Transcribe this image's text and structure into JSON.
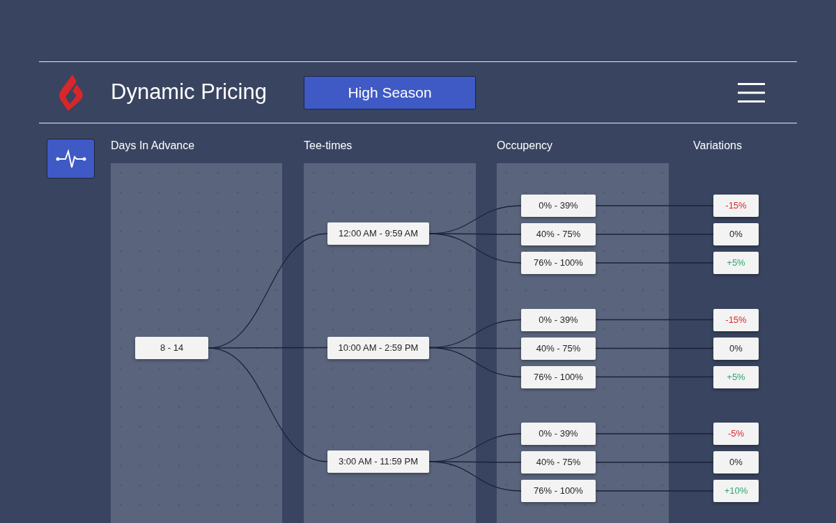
{
  "header": {
    "title": "Dynamic Pricing",
    "season_button": "High Season"
  },
  "columns": [
    "Days In Advance",
    "Tee-times",
    "Occupency",
    "Variations"
  ],
  "tree": {
    "label": "8 - 14",
    "children": [
      {
        "label": "12:00 AM - 9:59 AM",
        "children": [
          {
            "label": "0% - 39%",
            "variation": {
              "text": "-15%",
              "kind": "down"
            }
          },
          {
            "label": "40% - 75%",
            "variation": {
              "text": "0%",
              "kind": "flat"
            }
          },
          {
            "label": "76% - 100%",
            "variation": {
              "text": "+5%",
              "kind": "up"
            }
          }
        ]
      },
      {
        "label": "10:00 AM - 2:59 PM",
        "children": [
          {
            "label": "0% - 39%",
            "variation": {
              "text": "-15%",
              "kind": "down"
            }
          },
          {
            "label": "40% - 75%",
            "variation": {
              "text": "0%",
              "kind": "flat"
            }
          },
          {
            "label": "76% - 100%",
            "variation": {
              "text": "+5%",
              "kind": "up"
            }
          }
        ]
      },
      {
        "label": "3:00 AM - 11:59 PM",
        "children": [
          {
            "label": "0% - 39%",
            "variation": {
              "text": "-5%",
              "kind": "down"
            }
          },
          {
            "label": "40% - 75%",
            "variation": {
              "text": "0%",
              "kind": "flat"
            }
          },
          {
            "label": "76% - 100%",
            "variation": {
              "text": "+10%",
              "kind": "up"
            }
          }
        ]
      }
    ]
  }
}
